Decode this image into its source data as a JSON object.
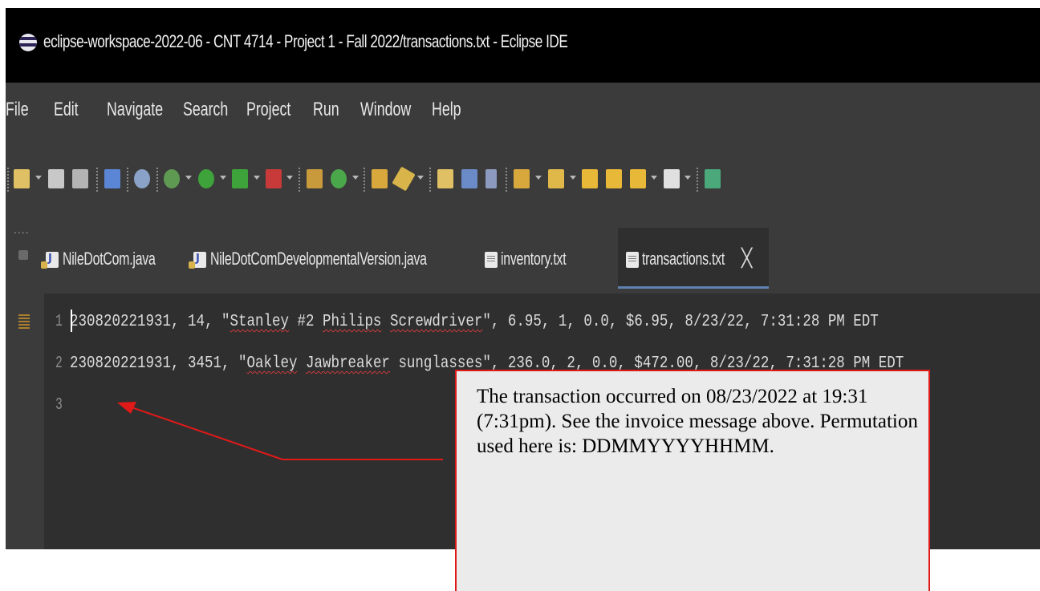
{
  "window": {
    "title": "eclipse-workspace-2022-06 - CNT 4714 - Project 1 - Fall 2022/transactions.txt - Eclipse IDE",
    "logo_icon": "eclipse-logo-icon"
  },
  "menubar": {
    "items": [
      "File",
      "Edit",
      "Navigate",
      "Search",
      "Project",
      "Run",
      "Window",
      "Help"
    ]
  },
  "toolbar": {
    "icons": [
      "new-wizard-icon",
      "save-icon",
      "save-all-icon",
      "console-icon",
      "search-icon",
      "debug-icon",
      "run-icon",
      "run-external-icon",
      "coverage-icon",
      "new-java-package-icon",
      "new-class-icon",
      "open-type-icon",
      "highlight-icon",
      "toggle-breadcrumb-icon",
      "toggle-block-selection-icon",
      "show-whitespace-icon",
      "next-annotation-icon",
      "previous-annotation-icon",
      "last-edit-location-icon",
      "back-icon",
      "forward-icon",
      "pin-editor-icon"
    ]
  },
  "tabs": [
    {
      "label": "NileDotCom.java",
      "icon": "java-file-icon",
      "active": false
    },
    {
      "label": "NileDotComDevelopmentalVersion.java",
      "icon": "java-file-icon",
      "active": false
    },
    {
      "label": "inventory.txt",
      "icon": "text-file-icon",
      "active": false
    },
    {
      "label": "transactions.txt",
      "icon": "text-file-icon",
      "active": true,
      "close": "X"
    }
  ],
  "editor": {
    "lines": [
      {
        "number": "1",
        "pre": "230820221931, 14, \"",
        "w1": "Stanley",
        "mid1": " #2 ",
        "w2": "Philips",
        "mid2": " ",
        "w3": "Screwdriver",
        "post": "\", 6.95, 1, 0.0, $6.95, 8/23/22, 7:31:28 PM EDT"
      },
      {
        "number": "2",
        "pre": "230820221931, 3451, \"",
        "w1": "Oakley",
        "mid1": " ",
        "w2": "Jawbreaker",
        "post": " sunglasses\", 236.0, 2, 0.0, $472.00, 8/23/22, 7:31:28 PM EDT"
      },
      {
        "number": "3",
        "text": ""
      }
    ]
  },
  "annotation": {
    "text": "The transaction occurred on 08/23/2022 at 19:31 (7:31pm).  See the invoice message above.  Permutation used here is: DDMMYYYYHHMM.",
    "border_color": "#e01919"
  }
}
